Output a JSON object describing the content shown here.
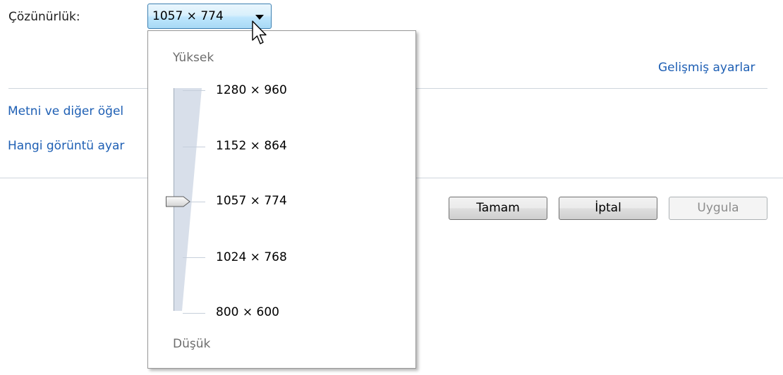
{
  "resolution": {
    "label": "Çözünürlük:",
    "selected": "1057 × 774",
    "dropdown": {
      "high_label": "Yüksek",
      "low_label": "Düşük",
      "options": [
        "1280 × 960",
        "1152 × 864",
        "1057 × 774",
        "1024 × 768",
        "800 × 600"
      ],
      "slider_value": "1057 × 774"
    }
  },
  "links": {
    "advanced": "Gelişmiş ayarlar",
    "text_size": "Metni ve diğer öğel",
    "which_settings": "Hangi görüntü ayar"
  },
  "buttons": {
    "ok": "Tamam",
    "cancel": "İptal",
    "apply": "Uygula"
  },
  "colors": {
    "link": "#1e5fb4",
    "combo_focus": "#a7d9f5"
  }
}
